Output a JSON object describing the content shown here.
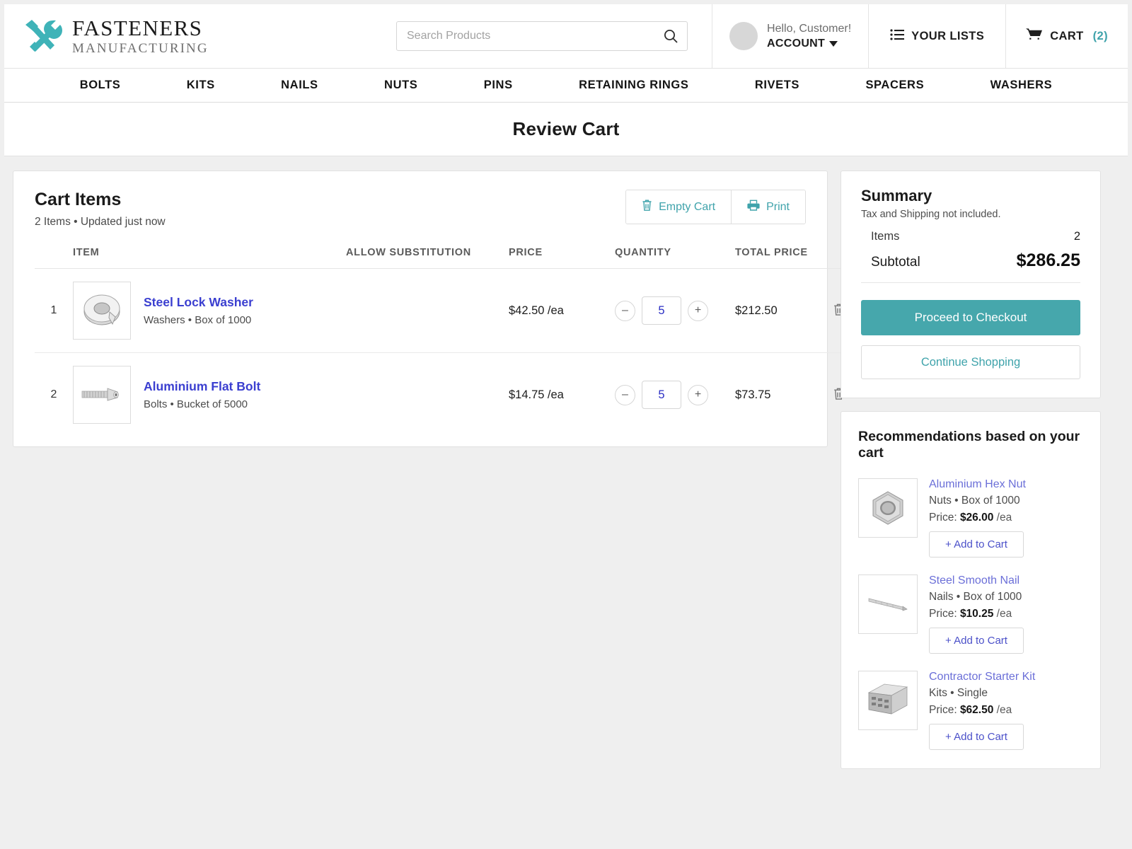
{
  "brand": {
    "name_top": "FASTENERS",
    "name_bottom": "MANUFACTURING"
  },
  "search": {
    "placeholder": "Search Products",
    "value": ""
  },
  "account": {
    "greeting": "Hello, Customer!",
    "label": "ACCOUNT"
  },
  "header": {
    "lists_label": "YOUR LISTS",
    "cart_label": "CART",
    "cart_count": "(2)",
    "accent_teal": "#3fa3ab"
  },
  "nav": {
    "items": [
      "BOLTS",
      "KITS",
      "NAILS",
      "NUTS",
      "PINS",
      "RETAINING RINGS",
      "RIVETS",
      "SPACERS",
      "WASHERS"
    ]
  },
  "page_title": "Review Cart",
  "cart": {
    "heading": "Cart Items",
    "subheading": "2 Items • Updated just now",
    "empty_cart_label": "Empty Cart",
    "print_label": "Print",
    "columns": [
      "ITEM",
      "ALLOW SUBSTITUTION",
      "PRICE",
      "QUANTITY",
      "TOTAL PRICE"
    ],
    "rows": [
      {
        "index": "1",
        "name": "Steel Lock Washer",
        "meta": "Washers • Box of 1000",
        "price": "$42.50",
        "price_unit": "/ea",
        "quantity": "5",
        "total": "$212.50",
        "thumb": "lock-washer-image"
      },
      {
        "index": "2",
        "name": "Aluminium Flat Bolt",
        "meta": "Bolts • Bucket of 5000",
        "price": "$14.75",
        "price_unit": "/ea",
        "quantity": "5",
        "total": "$73.75",
        "thumb": "flat-bolt-image"
      }
    ],
    "decrement_label": "–",
    "increment_label": "+"
  },
  "summary": {
    "heading": "Summary",
    "note": "Tax and Shipping not included.",
    "items_label": "Items",
    "items_value": "2",
    "subtotal_label": "Subtotal",
    "subtotal_value": "$286.25",
    "checkout_label": "Proceed to Checkout",
    "continue_label": "Continue Shopping",
    "primary_color": "#46a7ac"
  },
  "recommendations": {
    "heading": "Recommendations based on your cart",
    "add_label": "+ Add to Cart",
    "price_prefix": "Price:",
    "items": [
      {
        "name": "Aluminium Hex Nut",
        "meta": "Nuts • Box of 1000",
        "price": "$26.00",
        "price_unit": "/ea",
        "thumb": "hex-nut-image"
      },
      {
        "name": "Steel Smooth Nail",
        "meta": "Nails • Box of 1000",
        "price": "$10.25",
        "price_unit": "/ea",
        "thumb": "smooth-nail-image"
      },
      {
        "name": "Contractor Starter Kit",
        "meta": "Kits • Single",
        "price": "$62.50",
        "price_unit": "/ea",
        "thumb": "starter-kit-image"
      }
    ]
  }
}
